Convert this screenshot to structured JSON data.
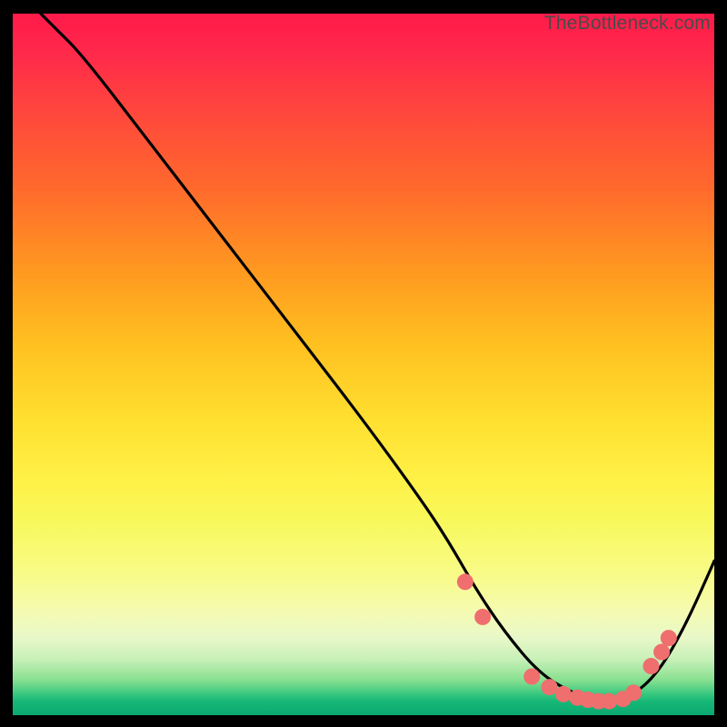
{
  "watermark": "TheBottleneck.com",
  "chart_data": {
    "type": "line",
    "title": "",
    "xlabel": "",
    "ylabel": "",
    "xlim": [
      0,
      100
    ],
    "ylim": [
      0,
      100
    ],
    "series": [
      {
        "name": "bottleneck-curve",
        "x": [
          4,
          6,
          10,
          20,
          30,
          40,
          50,
          58,
          62,
          66,
          70,
          75,
          80,
          84,
          88,
          92,
          96,
          100
        ],
        "y": [
          100,
          98,
          94,
          81,
          68,
          55,
          42,
          31,
          25,
          18,
          12,
          6,
          3,
          2,
          2.5,
          6,
          13,
          22
        ]
      }
    ],
    "markers": {
      "name": "highlight-dots",
      "color": "#ef6e6e",
      "radius": 9,
      "points": [
        {
          "x": 64.5,
          "y": 19
        },
        {
          "x": 67,
          "y": 14
        },
        {
          "x": 74,
          "y": 5.5
        },
        {
          "x": 76.5,
          "y": 4
        },
        {
          "x": 78.5,
          "y": 3
        },
        {
          "x": 80.5,
          "y": 2.5
        },
        {
          "x": 82,
          "y": 2.2
        },
        {
          "x": 83.5,
          "y": 2
        },
        {
          "x": 85,
          "y": 2
        },
        {
          "x": 87,
          "y": 2.3
        },
        {
          "x": 88.5,
          "y": 3.2
        },
        {
          "x": 91,
          "y": 7
        },
        {
          "x": 92.5,
          "y": 9
        },
        {
          "x": 93.5,
          "y": 11
        }
      ]
    }
  }
}
